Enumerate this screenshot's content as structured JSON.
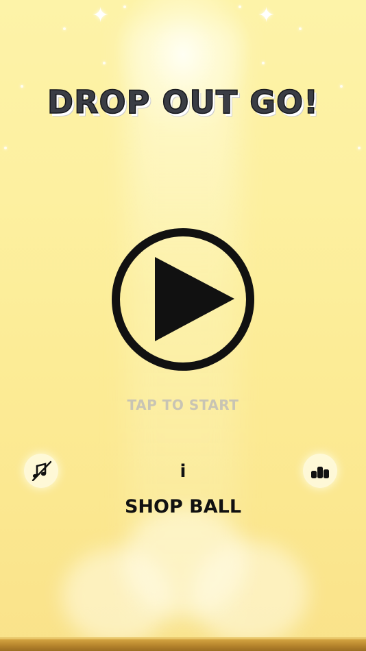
{
  "game": {
    "title": "DROP OUT GO!",
    "play_hint": "TAP TO START",
    "info_label": "i",
    "shop_label": "SHOP BALL"
  },
  "icons": {
    "play": "play-icon",
    "music": "music-muted-icon",
    "leaderboard": "leaderboard-icon"
  },
  "colors": {
    "background": "#fdf0a0",
    "title_fill": "#3a3d45",
    "hint_text": "#c8c4b4",
    "ink": "#111111",
    "ground": "#b8862d"
  }
}
